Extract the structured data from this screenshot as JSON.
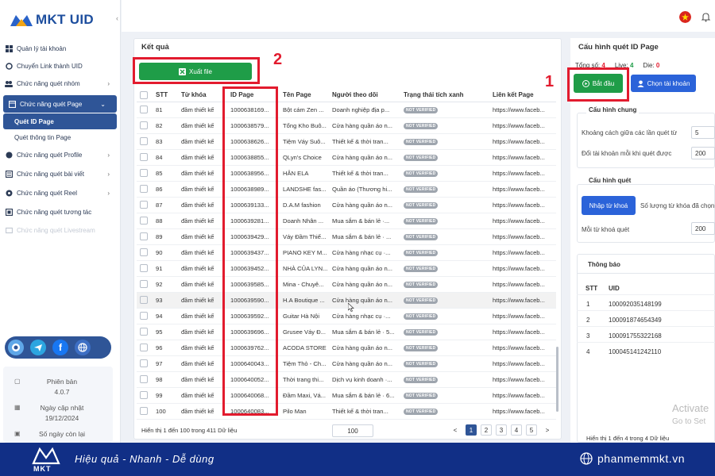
{
  "brand": {
    "logo_text": "MKT UID",
    "footer_logo": "MKT"
  },
  "sidebar": {
    "items": [
      {
        "label": "Quản lý tài khoản",
        "icon": "grid-icon"
      },
      {
        "label": "Chuyển Link thành UID",
        "icon": "link-icon"
      },
      {
        "label": "Chức năng quét nhóm",
        "icon": "group-icon"
      },
      {
        "label": "Chức năng quét Page",
        "icon": "page-icon"
      },
      {
        "label": "Chức năng quét Profile",
        "icon": "profile-icon"
      },
      {
        "label": "Chức năng quét bài viết",
        "icon": "post-icon"
      },
      {
        "label": "Chức năng quét Reel",
        "icon": "reel-icon"
      },
      {
        "label": "Chức năng quét tương tác",
        "icon": "interaction-icon"
      },
      {
        "label": "Chức năng quét Livestream",
        "icon": "livestream-icon"
      }
    ],
    "subitems": [
      "Quét ID Page",
      "Quét thông tin Page"
    ],
    "version_label": "Phiên bản",
    "version": "4.0.7",
    "update_label": "Ngày cập nhật",
    "update_date": "19/12/2024",
    "days_label": "Số ngày còn lại"
  },
  "results": {
    "title": "Kết quả",
    "export_label": "Xuất file",
    "columns": [
      "STT",
      "Từ khóa",
      "ID Page",
      "Tên Page",
      "Người theo dõi",
      "Trạng thái tích xanh",
      "Liên kết Page"
    ],
    "rows": [
      [
        "81",
        "đầm thiết kế",
        "1000638169...",
        "Bột cám Zen ...",
        "Doanh nghiệp địa p...",
        "NOT VERIFIED",
        "https://www.faceb..."
      ],
      [
        "82",
        "đầm thiết kế",
        "1000638579...",
        "Tổng Kho Buô...",
        "Cửa hàng quần áo n...",
        "NOT VERIFIED",
        "https://www.faceb..."
      ],
      [
        "83",
        "đầm thiết kế",
        "1000638626...",
        "Tiệm Váy Suô...",
        "Thiết kế & thời tran...",
        "NOT VERIFIED",
        "https://www.faceb..."
      ],
      [
        "84",
        "đầm thiết kế",
        "1000638855...",
        "QLyn's Choice",
        "Cửa hàng quần áo n...",
        "NOT VERIFIED",
        "https://www.faceb..."
      ],
      [
        "85",
        "đầm thiết kế",
        "1000638956...",
        "HÂN ELA",
        "Thiết kế & thời tran...",
        "NOT VERIFIED",
        "https://www.faceb..."
      ],
      [
        "86",
        "đầm thiết kế",
        "1000638989...",
        "LANDSHE fas...",
        "Quần áo (Thương hi...",
        "NOT VERIFIED",
        "https://www.faceb..."
      ],
      [
        "87",
        "đầm thiết kế",
        "1000639133...",
        "D.A.M fashion",
        "Cửa hàng quần áo n...",
        "NOT VERIFIED",
        "https://www.faceb..."
      ],
      [
        "88",
        "đầm thiết kế",
        "1000639281...",
        "Doanh Nhân ...",
        "Mua sắm & bán lẻ ·...",
        "NOT VERIFIED",
        "https://www.faceb..."
      ],
      [
        "89",
        "đầm thiết kế",
        "1000639429...",
        "Váy Đầm Thiế...",
        "Mua sắm & bán lẻ · ...",
        "NOT VERIFIED",
        "https://www.faceb..."
      ],
      [
        "90",
        "đầm thiết kế",
        "1000639437...",
        "PIANO KEY M...",
        "Cửa hàng nhạc cụ ·...",
        "NOT VERIFIED",
        "https://www.faceb..."
      ],
      [
        "91",
        "đầm thiết kế",
        "1000639452...",
        "NHÀ CỦA LYN...",
        "Cửa hàng quần áo n...",
        "NOT VERIFIED",
        "https://www.faceb..."
      ],
      [
        "92",
        "đầm thiết kế",
        "1000639585...",
        "Mina - Chuyê...",
        "Cửa hàng quần áo n...",
        "NOT VERIFIED",
        "https://www.faceb..."
      ],
      [
        "93",
        "đầm thiết kế",
        "1000639590...",
        "H.A Boutique ...",
        "Cửa hàng quần áo n...",
        "NOT VERIFIED",
        "https://www.faceb..."
      ],
      [
        "94",
        "đầm thiết kế",
        "1000639592...",
        "Guitar Hà Nội",
        "Cửa hàng nhạc cụ ·...",
        "NOT VERIFIED",
        "https://www.faceb..."
      ],
      [
        "95",
        "đầm thiết kế",
        "1000639696...",
        "Grusee Váy Đ...",
        "Mua sắm & bán lẻ · 5...",
        "NOT VERIFIED",
        "https://www.faceb..."
      ],
      [
        "96",
        "đầm thiết kế",
        "1000639762...",
        "ACODA STORE",
        "Cửa hàng quần áo n...",
        "NOT VERIFIED",
        "https://www.faceb..."
      ],
      [
        "97",
        "đầm thiết kế",
        "1000640043...",
        "Tiệm Thỏ - Ch...",
        "Cửa hàng quần áo n...",
        "NOT VERIFIED",
        "https://www.faceb..."
      ],
      [
        "98",
        "đầm thiết kế",
        "1000640052...",
        "Thời trang thi...",
        "Dịch vụ kinh doanh ·...",
        "NOT VERIFIED",
        "https://www.faceb..."
      ],
      [
        "99",
        "đầm thiết kế",
        "1000640068...",
        "Đầm Maxi, Vá...",
        "Mua sắm & bán lẻ · 6...",
        "NOT VERIFIED",
        "https://www.faceb..."
      ],
      [
        "100",
        "đầm thiết kế",
        "1000640083...",
        "Pilo Man",
        "Thiết kế & thời tran...",
        "NOT VERIFIED",
        "https://www.faceb..."
      ]
    ],
    "footer_text": "Hiển thị 1 đến 100 trong 411 Dữ liệu",
    "page_size": "100",
    "pages": [
      "<",
      "1",
      "2",
      "3",
      "4",
      "5",
      ">"
    ]
  },
  "config": {
    "title": "Cấu hình quét ID Page",
    "stats": [
      {
        "label": "Tổng số:",
        "value": "4"
      },
      {
        "label": "Live:",
        "value": "4"
      },
      {
        "label": "Die:",
        "value": "0"
      }
    ],
    "start_label": "Bắt đầu",
    "choose_account_label": "Chọn tài khoản",
    "general_title": "Cấu hình chung",
    "delay_label": "Khoảng cách giữa các lần quét từ",
    "delay_value": "5",
    "switch_label": "Đổi tài khoản mỗi khi quét được",
    "switch_value": "200",
    "scan_title": "Cấu hình quét",
    "keyword_btn": "Nhập từ khoá",
    "keyword_count_label": "Số lượng từ khóa đã chọn",
    "per_keyword_label": "Mỗi từ khoá quét",
    "per_keyword_value": "200",
    "notice_title": "Thông báo",
    "notice_columns": [
      "STT",
      "UID"
    ],
    "notice_rows": [
      [
        "1",
        "100092035148199"
      ],
      [
        "2",
        "100091874654349"
      ],
      [
        "3",
        "100091755322168"
      ],
      [
        "4",
        "100045141242110"
      ]
    ],
    "notice_footer": "Hiển thị 1 đến 4 trong 4 Dữ liệu",
    "watermark1": "Activate",
    "watermark2": "Go to Set"
  },
  "annotations": {
    "n1": "1",
    "n2": "2"
  },
  "footer": {
    "slogan": "Hiệu quả - Nhanh - Dễ dùng",
    "website": "phanmemmkt.vn"
  },
  "colors": {
    "primary": "#2f5597",
    "green": "#1f9d48",
    "red_box": "#e21b2e",
    "footer": "#112f86",
    "blue_btn": "#2b63d9"
  }
}
